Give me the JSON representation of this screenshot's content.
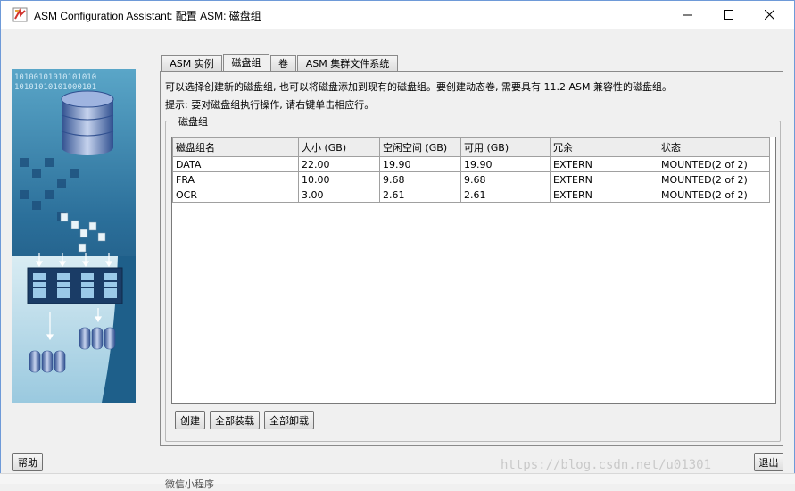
{
  "window": {
    "title": "ASM Configuration Assistant: 配置 ASM: 磁盘组"
  },
  "sidebar": {
    "binary_rows": [
      "10100101010101010",
      "10101010101000101"
    ]
  },
  "tabs": [
    {
      "label": "ASM 实例",
      "active": false
    },
    {
      "label": "磁盘组",
      "active": true
    },
    {
      "label": "卷",
      "active": false
    },
    {
      "label": "ASM 集群文件系统",
      "active": false
    }
  ],
  "main": {
    "info_line": "可以选择创建新的磁盘组, 也可以将磁盘添加到现有的磁盘组。要创建动态卷, 需要具有 11.2 ASM 兼容性的磁盘组。",
    "hint_line": "提示: 要对磁盘组执行操作, 请右键单击相应行。",
    "group_title": "磁盘组"
  },
  "table": {
    "columns": [
      "磁盘组名",
      "大小 (GB)",
      "空闲空间 (GB)",
      "可用 (GB)",
      "冗余",
      "状态"
    ],
    "rows": [
      [
        "DATA",
        "22.00",
        "19.90",
        "19.90",
        "EXTERN",
        "MOUNTED(2 of 2)"
      ],
      [
        "FRA",
        "10.00",
        "9.68",
        "9.68",
        "EXTERN",
        "MOUNTED(2 of 2)"
      ],
      [
        "OCR",
        "3.00",
        "2.61",
        "2.61",
        "EXTERN",
        "MOUNTED(2 of 2)"
      ]
    ]
  },
  "buttons": {
    "create": "创建",
    "mount_all": "全部装载",
    "dismount_all": "全部卸载",
    "help": "帮助",
    "exit": "退出"
  },
  "watermark": "https://blog.csdn.net/u01301",
  "background_app": {
    "text": "微信小程序"
  },
  "colors": {
    "window_border": "#6e9ad8",
    "art_background": "#1a4f7a",
    "art_highlight": "#39a9c6"
  }
}
